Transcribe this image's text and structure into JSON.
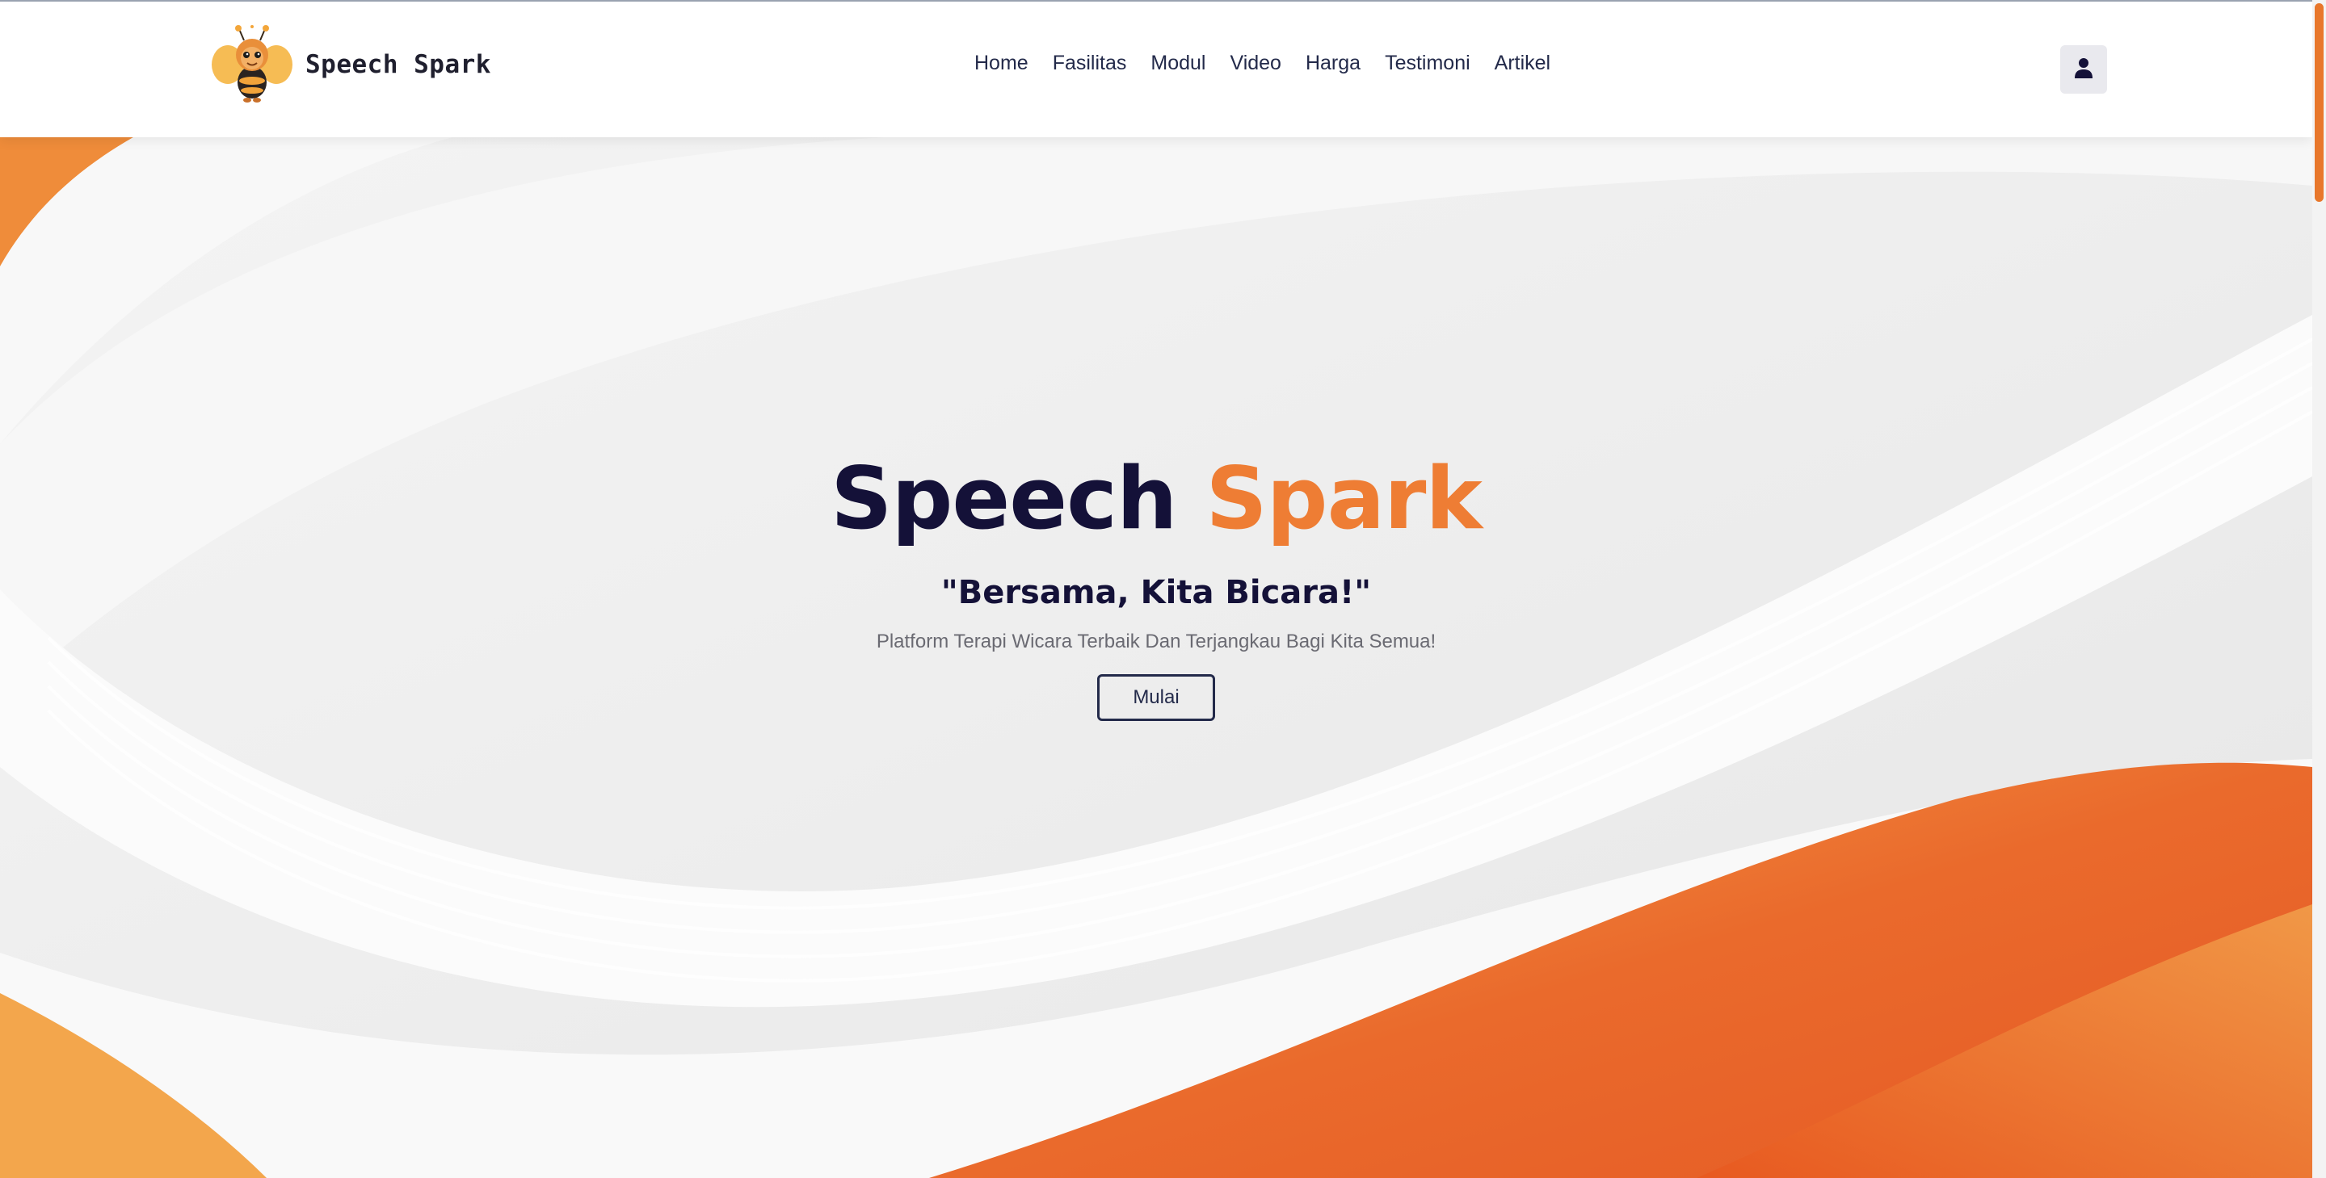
{
  "brand": {
    "name": "Speech Spark",
    "logo_icon": "bee-mascot-icon"
  },
  "nav": {
    "links": [
      "Home",
      "Fasilitas",
      "Modul",
      "Video",
      "Harga",
      "Testimoni",
      "Artikel"
    ],
    "user_icon": "user-icon"
  },
  "hero": {
    "title_part1": "Speech",
    "title_part2": "Spark",
    "tagline": "\"Bersama, Kita Bicara!\"",
    "description": "Platform Terapi Wicara Terbaik Dan Terjangkau Bagi Kita Semua!",
    "button_label": "Mulai"
  },
  "colors": {
    "accent": "#ee7d34",
    "dark": "#141138",
    "nav_text": "#232a4a"
  }
}
